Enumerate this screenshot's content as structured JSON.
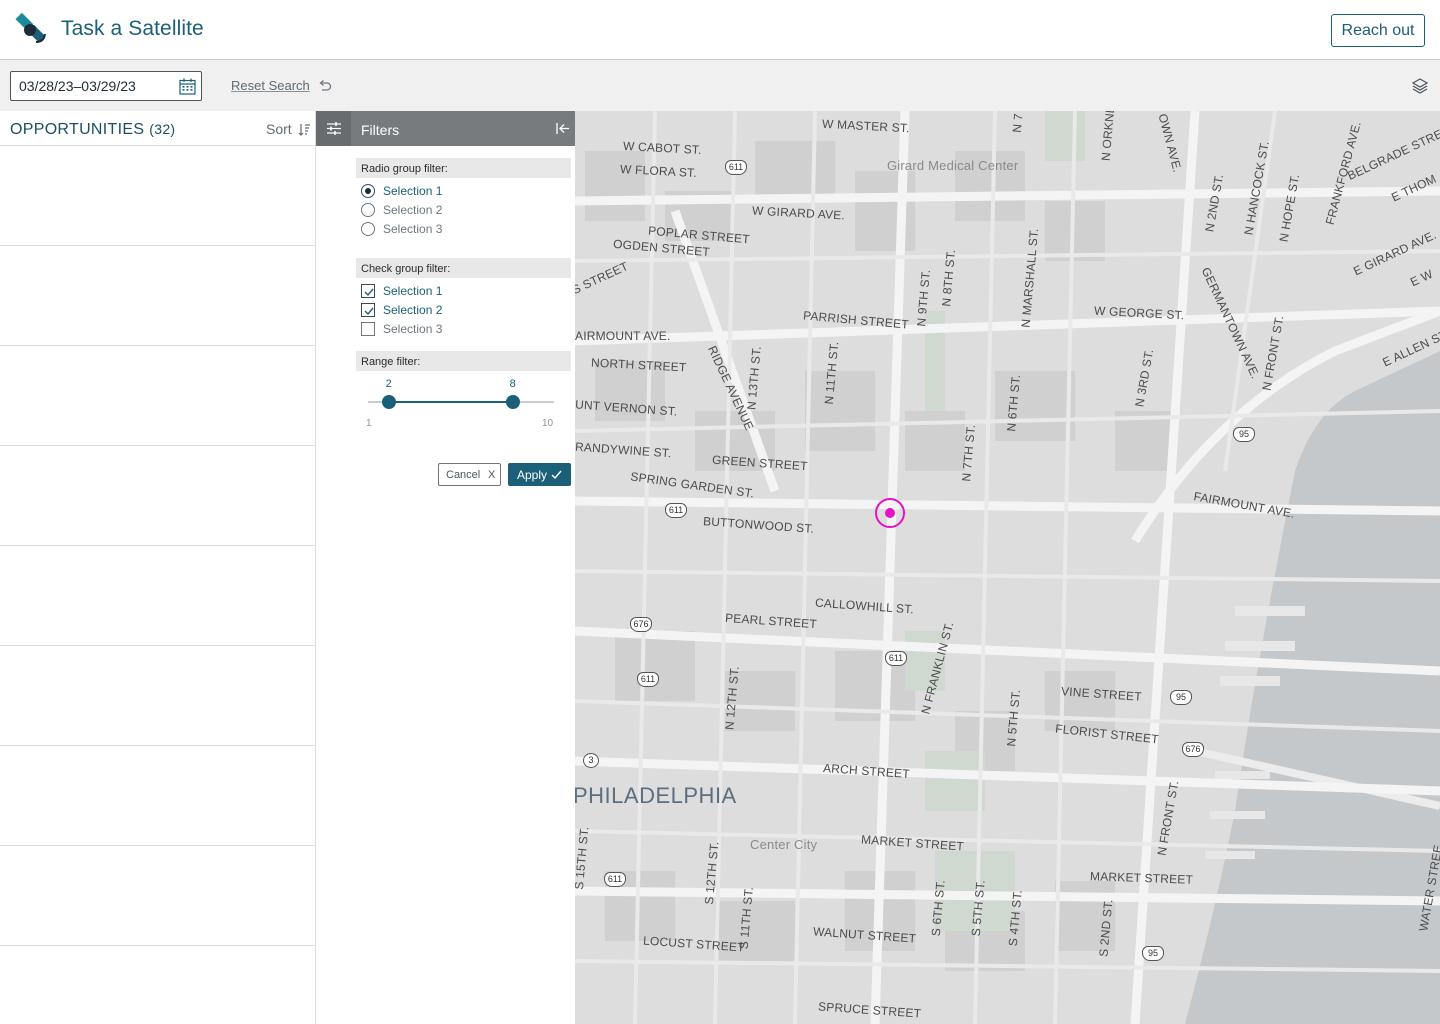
{
  "header": {
    "app_title": "Task a Satellite",
    "reach_out_label": "Reach out"
  },
  "toolbar": {
    "date_range": "03/28/23–03/29/23",
    "reset_label": "Reset Search"
  },
  "opportunities": {
    "title": "OPPORTUNITIES",
    "count": "(32)",
    "sort_label": "Sort"
  },
  "filters": {
    "title": "Filters",
    "radio_group": {
      "label": "Radio group filter:",
      "options": [
        "Selection 1",
        "Selection 2",
        "Selection 3"
      ],
      "selected": "Selection 1"
    },
    "check_group": {
      "label": "Check group filter:",
      "options": [
        "Selection 1",
        "Selection 2",
        "Selection 3"
      ],
      "checked": [
        "Selection 1",
        "Selection 2"
      ]
    },
    "range": {
      "label": "Range filter:",
      "min": "1",
      "max": "10",
      "low": "2",
      "high": "8"
    },
    "cancel_label": "Cancel",
    "cancel_x": "X",
    "apply_label": "Apply"
  },
  "map": {
    "labels": {
      "master": "W MASTER ST.",
      "cabot": "W CABOT ST.",
      "flora": "W FLORA ST.",
      "girard_med": "Girard Medical Center",
      "girard_ave": "W GIRARD AVE.",
      "poplar": "POPLAR STREET",
      "ogden": "OGDEN STREET",
      "parrish": "PARRISH STREET",
      "fairmount": "AIRMOUNT AVE.",
      "north_st": "NORTH STREET",
      "mt_vernon": "UNT VERNON ST.",
      "brandywine": "RANDYWINE ST.",
      "green": "GREEN STREET",
      "spring_garden": "SPRING GARDEN ST.",
      "buttonwood": "BUTTONWOOD ST.",
      "callowhill": "CALLOWHILL ST.",
      "pearl": "PEARL STREET",
      "vine": "VINE STREET",
      "florist": "FLORIST STREET",
      "arch": "ARCH STREET",
      "philadelphia": "PHILADELPHIA",
      "center_city": "Center City",
      "market": "MARKET STREET",
      "market2": "MARKET STREET",
      "walnut": "WALNUT STREET",
      "locust": "LOCUST STREET",
      "spruce": "SPRUCE STREET",
      "w_george": "W GEORGE ST.",
      "fairmount_ave": "FAIRMOUNT AVE.",
      "e_girard": "E GIRARD AVE.",
      "e_allen": "E ALLEN ST.",
      "belgrade": "BELGRADE STREE",
      "frankford": "FRANKFORD AVE.",
      "germantown": "GERMANTOWN AVE.",
      "ridge": "RIDGE AVENUE",
      "n_9th": "N 9TH ST.",
      "n_8th": "N 8TH ST.",
      "n_marshall": "N MARSHALL ST.",
      "n_6th": "N 6TH ST.",
      "n_7th": "N 7TH ST.",
      "n_11th": "N 11TH ST.",
      "n_13th": "N 13TH ST.",
      "n_3rd": "N 3RD ST.",
      "n_2nd": "N 2ND ST.",
      "n_front": "N FRONT ST.",
      "n_hancock": "N HANCOCK ST.",
      "n_hope": "N HOPE ST.",
      "n_franklin": "N FRANKLIN ST.",
      "n_12th": "N 12TH ST.",
      "n_5th": "N 5TH ST.",
      "s_15th": "S 15TH ST.",
      "s_12th": "S 12TH ST.",
      "s_11th": "S 11TH ST.",
      "s_6th": "S 6TH ST.",
      "s_5th": "S 5TH ST.",
      "s_4th": "S 4TH ST.",
      "s_2nd": "S 2ND ST.",
      "s_front": "N FRONT ST.",
      "water": "WATER STREE",
      "orkney": "N ORKNE",
      "own_ave": "OWN AVE.",
      "e_thom": "E THOM",
      "e_w": "E W",
      "n_7": "N 7",
      "s_street": "S STREET"
    },
    "shields": [
      "611",
      "611",
      "611",
      "611",
      "611",
      "676",
      "676",
      "676",
      "95",
      "95",
      "95",
      "3"
    ]
  }
}
